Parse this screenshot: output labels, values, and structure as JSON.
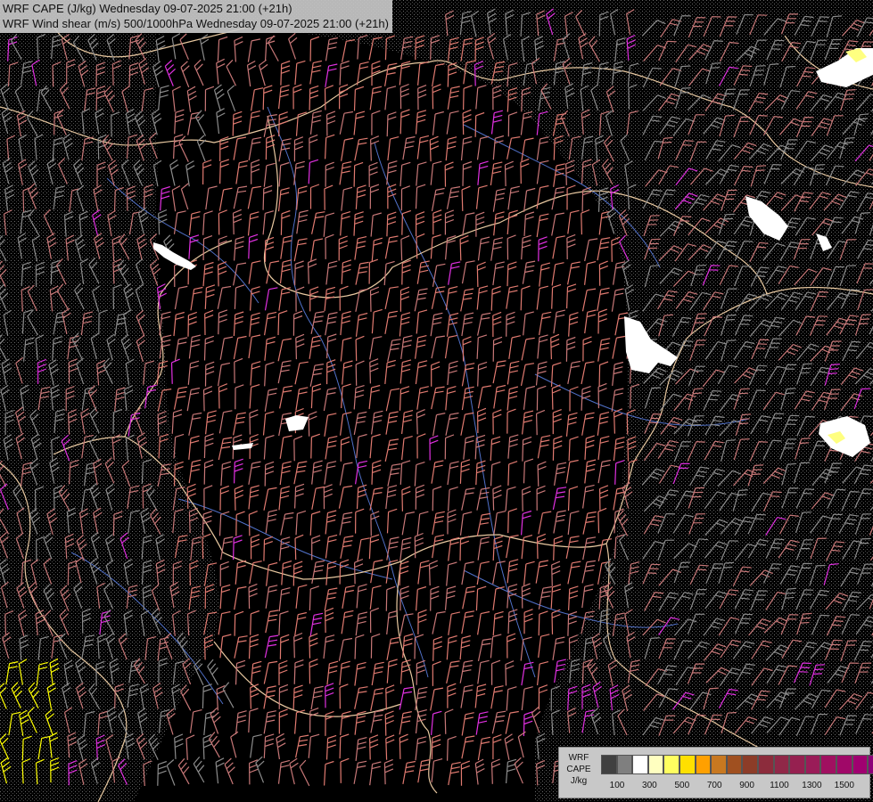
{
  "titles": {
    "line1": "WRF CAPE (J/kg) Wednesday 09-07-2025 21:00 (+21h)",
    "line2": "WRF Wind shear (m/s) 500/1000hPa Wednesday 09-07-2025 21:00 (+21h)"
  },
  "legend": {
    "model": "WRF",
    "variable": "CAPE",
    "unit": "J/kg",
    "colors": [
      "#404040",
      "#7f7f7f",
      "#ffffff",
      "#ffffc0",
      "#ffff60",
      "#ffe000",
      "#ffa000",
      "#c87820",
      "#a05020",
      "#8c3c28",
      "#8c2c3c",
      "#902848",
      "#962050",
      "#9a1c58",
      "#a01060",
      "#a00868",
      "#a00070",
      "#8c0078"
    ],
    "tick_labels": [
      "100",
      "300",
      "500",
      "700",
      "900",
      "1100",
      "1300",
      "1500"
    ]
  },
  "colors": {
    "background": "#000000",
    "barb_grey": "#8c8c8c",
    "barb_pink": "#c87878",
    "barb_salmon": "#e07a70",
    "barb_magenta": "#e030e0",
    "barb_yellow": "#ffff00",
    "border": "#e8c8a0",
    "river": "#5070c8",
    "stipple": "#5a5a5a"
  }
}
